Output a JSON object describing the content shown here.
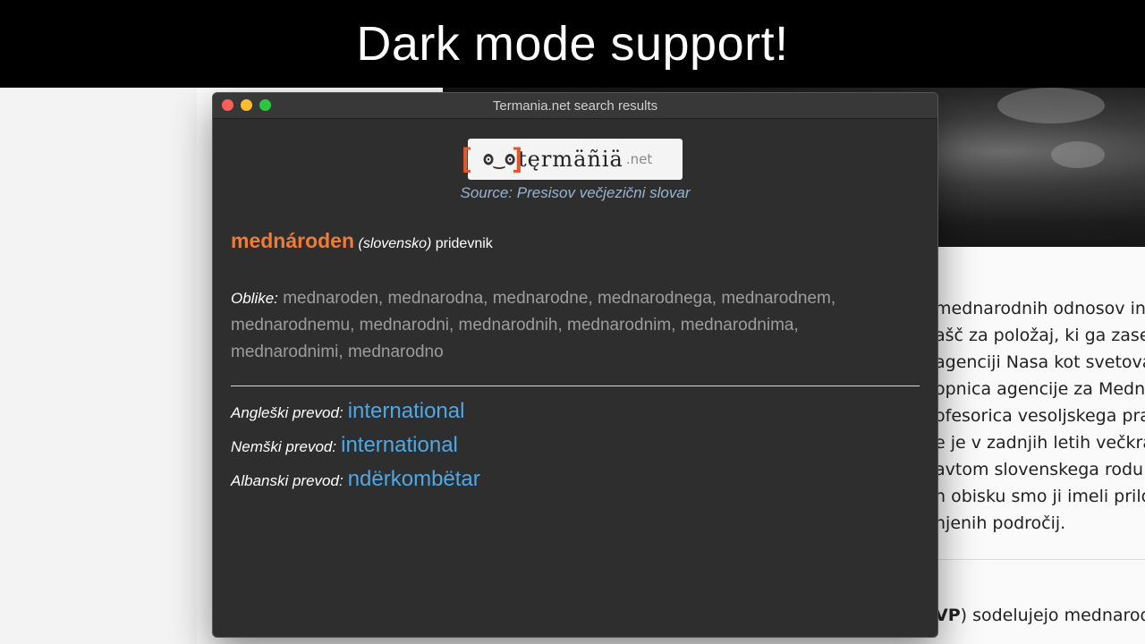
{
  "banner": {
    "text": "Dark mode support!"
  },
  "window": {
    "title": "Termania.net search results",
    "logo": {
      "word": "tęrmäñiä",
      "tld": ".net"
    },
    "source": "Source: Presisov večjezični slovar",
    "entry": {
      "headword": "mednároden",
      "language": "(slovensko)",
      "pos": "pridevnik",
      "forms_label": "Oblike:",
      "forms_lines": [
        "mednaroden, mednarodna, mednarodne, mednarodnega, mednarodnem,",
        "mednarodnemu, mednarodni, mednarodnih, mednarodnim, mednarodnima,",
        "mednarodnimi, mednarodno"
      ]
    },
    "translations": [
      {
        "label": "Angleški prevod:",
        "value": "international"
      },
      {
        "label": "Nemški prevod:",
        "value": "international"
      },
      {
        "label": "Albanski prevod:",
        "value": "ndërkombëtar"
      }
    ]
  },
  "background": {
    "article_lines": [
      "mednarodnih odnosov in",
      "ašč za položaj, ki ga zased",
      "agenciji Nasa kot svetova",
      "opnica agencije za Medn",
      "ofesorica vesoljskega pra",
      "e je v zadnjih letih večkrat",
      "avtom slovenskega rodu",
      "n obisku smo ji imeli prilo",
      "njenih področij."
    ],
    "bottom_prefix": "VP",
    "bottom_suffix": ") sodelujejo mednarod"
  }
}
